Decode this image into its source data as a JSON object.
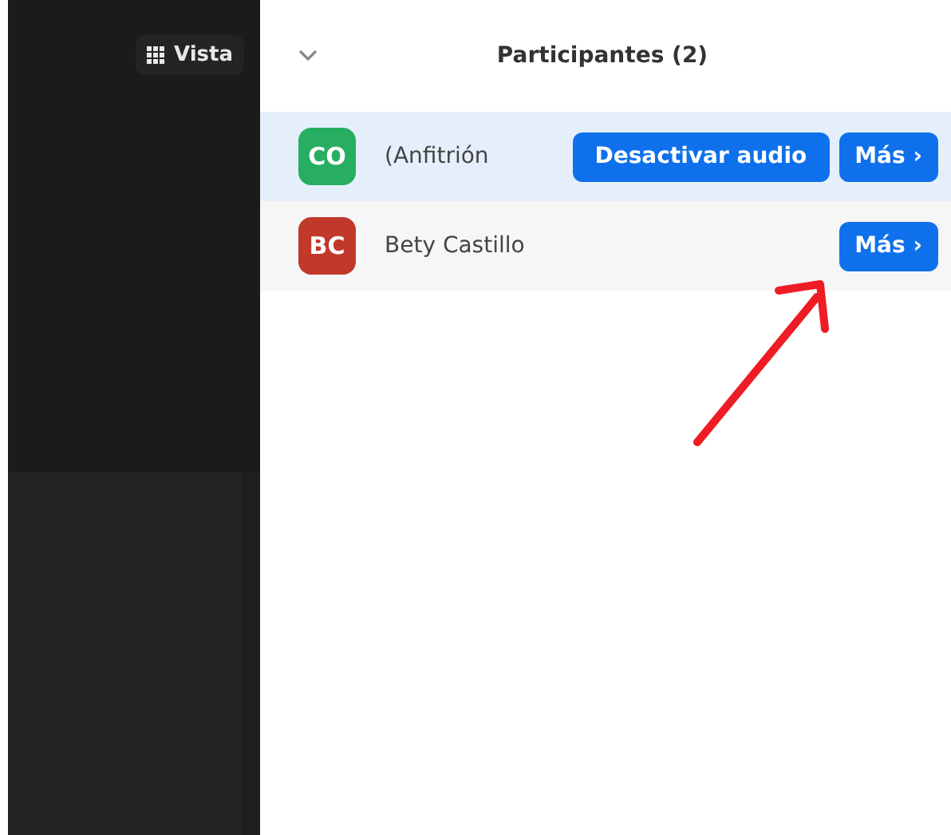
{
  "view_button": {
    "label": "Vista"
  },
  "participants_panel": {
    "title": "Participantes (2)",
    "participants": [
      {
        "initials": "CO",
        "color": "#27ae60",
        "name": "(Anfitrión",
        "selected": true,
        "buttons": [
          {
            "kind": "action",
            "label": "Desactivar audio"
          },
          {
            "kind": "more",
            "label": "Más",
            "caret": "›"
          }
        ]
      },
      {
        "initials": "BC",
        "color": "#c0392b",
        "name": "Bety Castillo",
        "selected": false,
        "buttons": [
          {
            "kind": "more",
            "label": "Más",
            "caret": "›"
          }
        ]
      }
    ]
  }
}
